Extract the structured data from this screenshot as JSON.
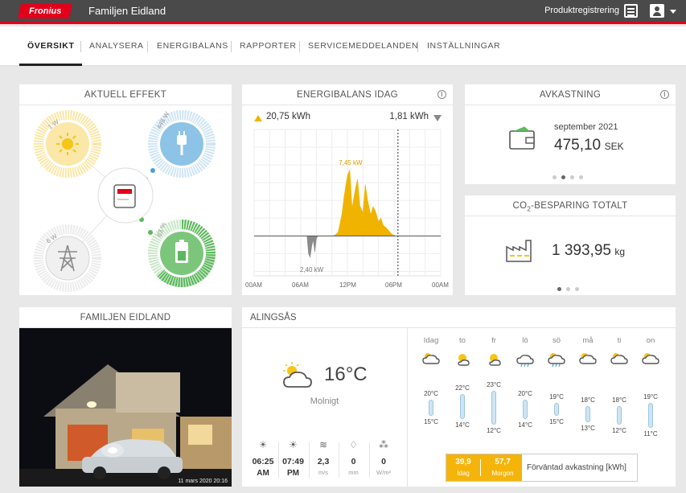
{
  "header": {
    "logo_text": "Fronius",
    "system_name": "Familjen Eidland",
    "product_registration": "Produktregistrering"
  },
  "nav": {
    "tabs": [
      "ÖVERSIKT",
      "ANALYSERA",
      "ENERGIBALANS",
      "RAPPORTER",
      "SERVICEMEDDELANDEN",
      "INSTÄLLNINGAR"
    ],
    "active": "ÖVERSIKT"
  },
  "power_flow": {
    "title": "AKTUELL EFFEKT",
    "pv": "1 W",
    "load": "448 W",
    "grid": "6 W",
    "battery": "63 %",
    "battery_level": 0.63
  },
  "energy_balance": {
    "title": "ENERGIBALANS IDAG",
    "produced": "20,75 kWh",
    "consumed": "1,81 kWh",
    "chart_data": {
      "type": "area",
      "x_ticks": [
        "00AM",
        "06AM",
        "12PM",
        "06PM",
        "00AM"
      ],
      "peak_label": "7,45 kW",
      "min_label": "2,40 kW",
      "series": [
        {
          "x": [
            7.0,
            7.3,
            7.6,
            8.0,
            8.4,
            8.8,
            9.2,
            9.6,
            10.0,
            10.4,
            10.8,
            11.0,
            11.3,
            11.6,
            12.0,
            12.3,
            12.6,
            13.0,
            13.3,
            13.6,
            14.0,
            14.3,
            14.6,
            15.0,
            15.3,
            15.6,
            16.0,
            16.3,
            16.6,
            17.0,
            17.3,
            17.6,
            17.9,
            18.2
          ],
          "values": [
            0,
            0,
            0,
            0,
            0,
            0,
            0,
            0,
            0,
            0.1,
            0.4,
            1.2,
            2.5,
            4.6,
            6.8,
            7.45,
            3.1,
            5.2,
            6.4,
            3.4,
            2.6,
            5.8,
            4.0,
            2.4,
            3.3,
            2.8,
            1.6,
            2.0,
            1.2,
            0.9,
            0.6,
            0.3,
            0.1,
            0
          ]
        },
        {
          "x": [
            6.8,
            7.0,
            7.2,
            7.4,
            7.6,
            7.8,
            8.0,
            8.2
          ],
          "values": [
            0,
            -2.0,
            -2.4,
            -1.2,
            -0.4,
            -1.8,
            -0.3,
            0
          ]
        }
      ],
      "ylim": [
        -4.5,
        12
      ],
      "xlim": [
        0,
        24
      ]
    }
  },
  "avkastning": {
    "title": "AVKASTNING",
    "period": "september 2021",
    "value": "475,10",
    "unit": "SEK"
  },
  "co2": {
    "title_pre": "CO",
    "title_sub": "2",
    "title_post": "-BESPARING TOTALT",
    "value": "1 393,95",
    "unit": "kg"
  },
  "photo": {
    "title": "FAMILJEN EIDLAND",
    "caption": "11 mars 2020 20:16"
  },
  "weather": {
    "title": "ALINGSÅS",
    "temp": "16°C",
    "condition": "Molnigt",
    "stats": [
      {
        "value": "06:25",
        "unit": "AM"
      },
      {
        "value": "07:49",
        "unit": "PM"
      },
      {
        "value": "2,3",
        "unit": "m/s"
      },
      {
        "value": "0",
        "unit": "mm"
      },
      {
        "value": "0",
        "unit": "W/m²"
      }
    ],
    "days": [
      {
        "day": "Idag",
        "max": "20°C",
        "min": "15°C",
        "icon": "cloud-sun-icon",
        "hi": 20,
        "lo": 15
      },
      {
        "day": "to",
        "max": "22°C",
        "min": "14°C",
        "icon": "sun-icon",
        "hi": 22,
        "lo": 14
      },
      {
        "day": "fr",
        "max": "23°C",
        "min": "12°C",
        "icon": "sun-icon",
        "hi": 23,
        "lo": 12
      },
      {
        "day": "lö",
        "max": "20°C",
        "min": "14°C",
        "icon": "cloud-rain-icon",
        "hi": 20,
        "lo": 14
      },
      {
        "day": "sö",
        "max": "19°C",
        "min": "15°C",
        "icon": "sun-cloud-rain-icon",
        "hi": 19,
        "lo": 15
      },
      {
        "day": "må",
        "max": "18°C",
        "min": "13°C",
        "icon": "cloud-sun-icon",
        "hi": 18,
        "lo": 13
      },
      {
        "day": "ti",
        "max": "18°C",
        "min": "12°C",
        "icon": "cloud-sun-icon",
        "hi": 18,
        "lo": 12
      },
      {
        "day": "on",
        "max": "19°C",
        "min": "11°C",
        "icon": "cloud-sun-icon",
        "hi": 19,
        "lo": 11
      }
    ],
    "forecast": {
      "today_value": "39,9",
      "today_label": "Idag",
      "tomorrow_value": "57,7",
      "tomorrow_label": "Morgon",
      "label": "Förväntad avkastning [kWh]"
    }
  },
  "colors": {
    "accent": "#e2001a",
    "solar": "#f5c518",
    "load": "#8cc3e6",
    "battery": "#5cb85c",
    "grid": "#9a9a9a"
  }
}
